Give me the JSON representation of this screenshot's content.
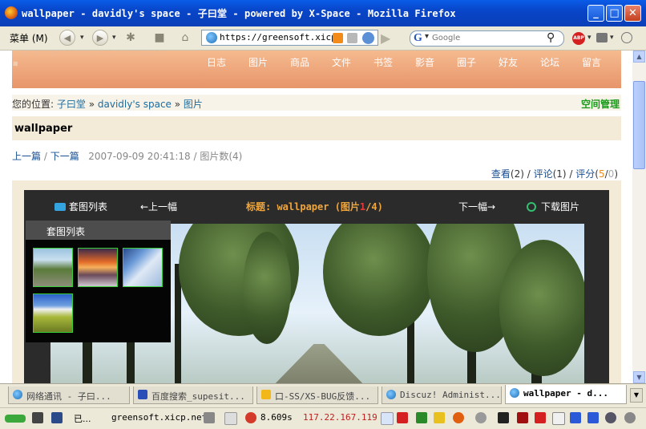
{
  "window": {
    "title": "wallpaper - davidly's space - 子曰堂 - powered by X-Space - Mozilla Firefox",
    "buttons": {
      "minimize": "_",
      "maximize": "□",
      "close": "✕"
    }
  },
  "toolbar": {
    "menu_label": "菜单 (M)",
    "back": "◀",
    "forward": "▶",
    "url": "https://greensoft.xicp.",
    "search_placeholder": "Google",
    "search_engine_letter": "G",
    "abp_label": "ABP"
  },
  "page": {
    "faded_url": "http://greensoft.xicp.net/space/?",
    "nav": [
      "日志",
      "图片",
      "商品",
      "文件",
      "书签",
      "影音",
      "圈子",
      "好友",
      "论坛",
      "留言"
    ],
    "breadcrumb": {
      "label": "您的位置:",
      "items": [
        "子曰堂",
        "davidly's space",
        "图片"
      ],
      "separator": "»",
      "manage": "空间管理"
    },
    "heading": "wallpaper",
    "meta": {
      "prev": "上一篇",
      "next": "下一篇",
      "sep": "/",
      "date": "2007-09-09 20:41:18",
      "photo_count": "图片数(4)"
    },
    "stats": {
      "view_label": "查看",
      "view_count": "2",
      "comment_label": "评论",
      "comment_count": "1",
      "rating_label": "评分",
      "rating_a": "5",
      "rating_b": "0"
    },
    "viewer": {
      "album_list": "套图列表",
      "prev_photo": "←上一幅",
      "title_prefix": "标题: wallpaper (图片",
      "current": "1",
      "title_suffix": "/4)",
      "next_photo": "下一幅→",
      "download": "下载图片",
      "panel_header": "套图列表",
      "thumbnails": [
        "road-trees",
        "sunset-rocks",
        "snow-slope",
        "meadow-sky"
      ]
    }
  },
  "tabs": [
    {
      "label": "网络通讯 - 子曰...",
      "active": false
    },
    {
      "label": "百度搜索_supesit...",
      "active": false
    },
    {
      "label": "口-SS/XS-BUG反馈...",
      "active": false
    },
    {
      "label": "Discuz! Administ...",
      "active": false
    },
    {
      "label": "wallpaper - d...",
      "active": true
    }
  ],
  "status": {
    "state": "已...",
    "host": "greensoft.xicp.net",
    "load_time": "8.609s",
    "ip": "117.22.167.119"
  }
}
